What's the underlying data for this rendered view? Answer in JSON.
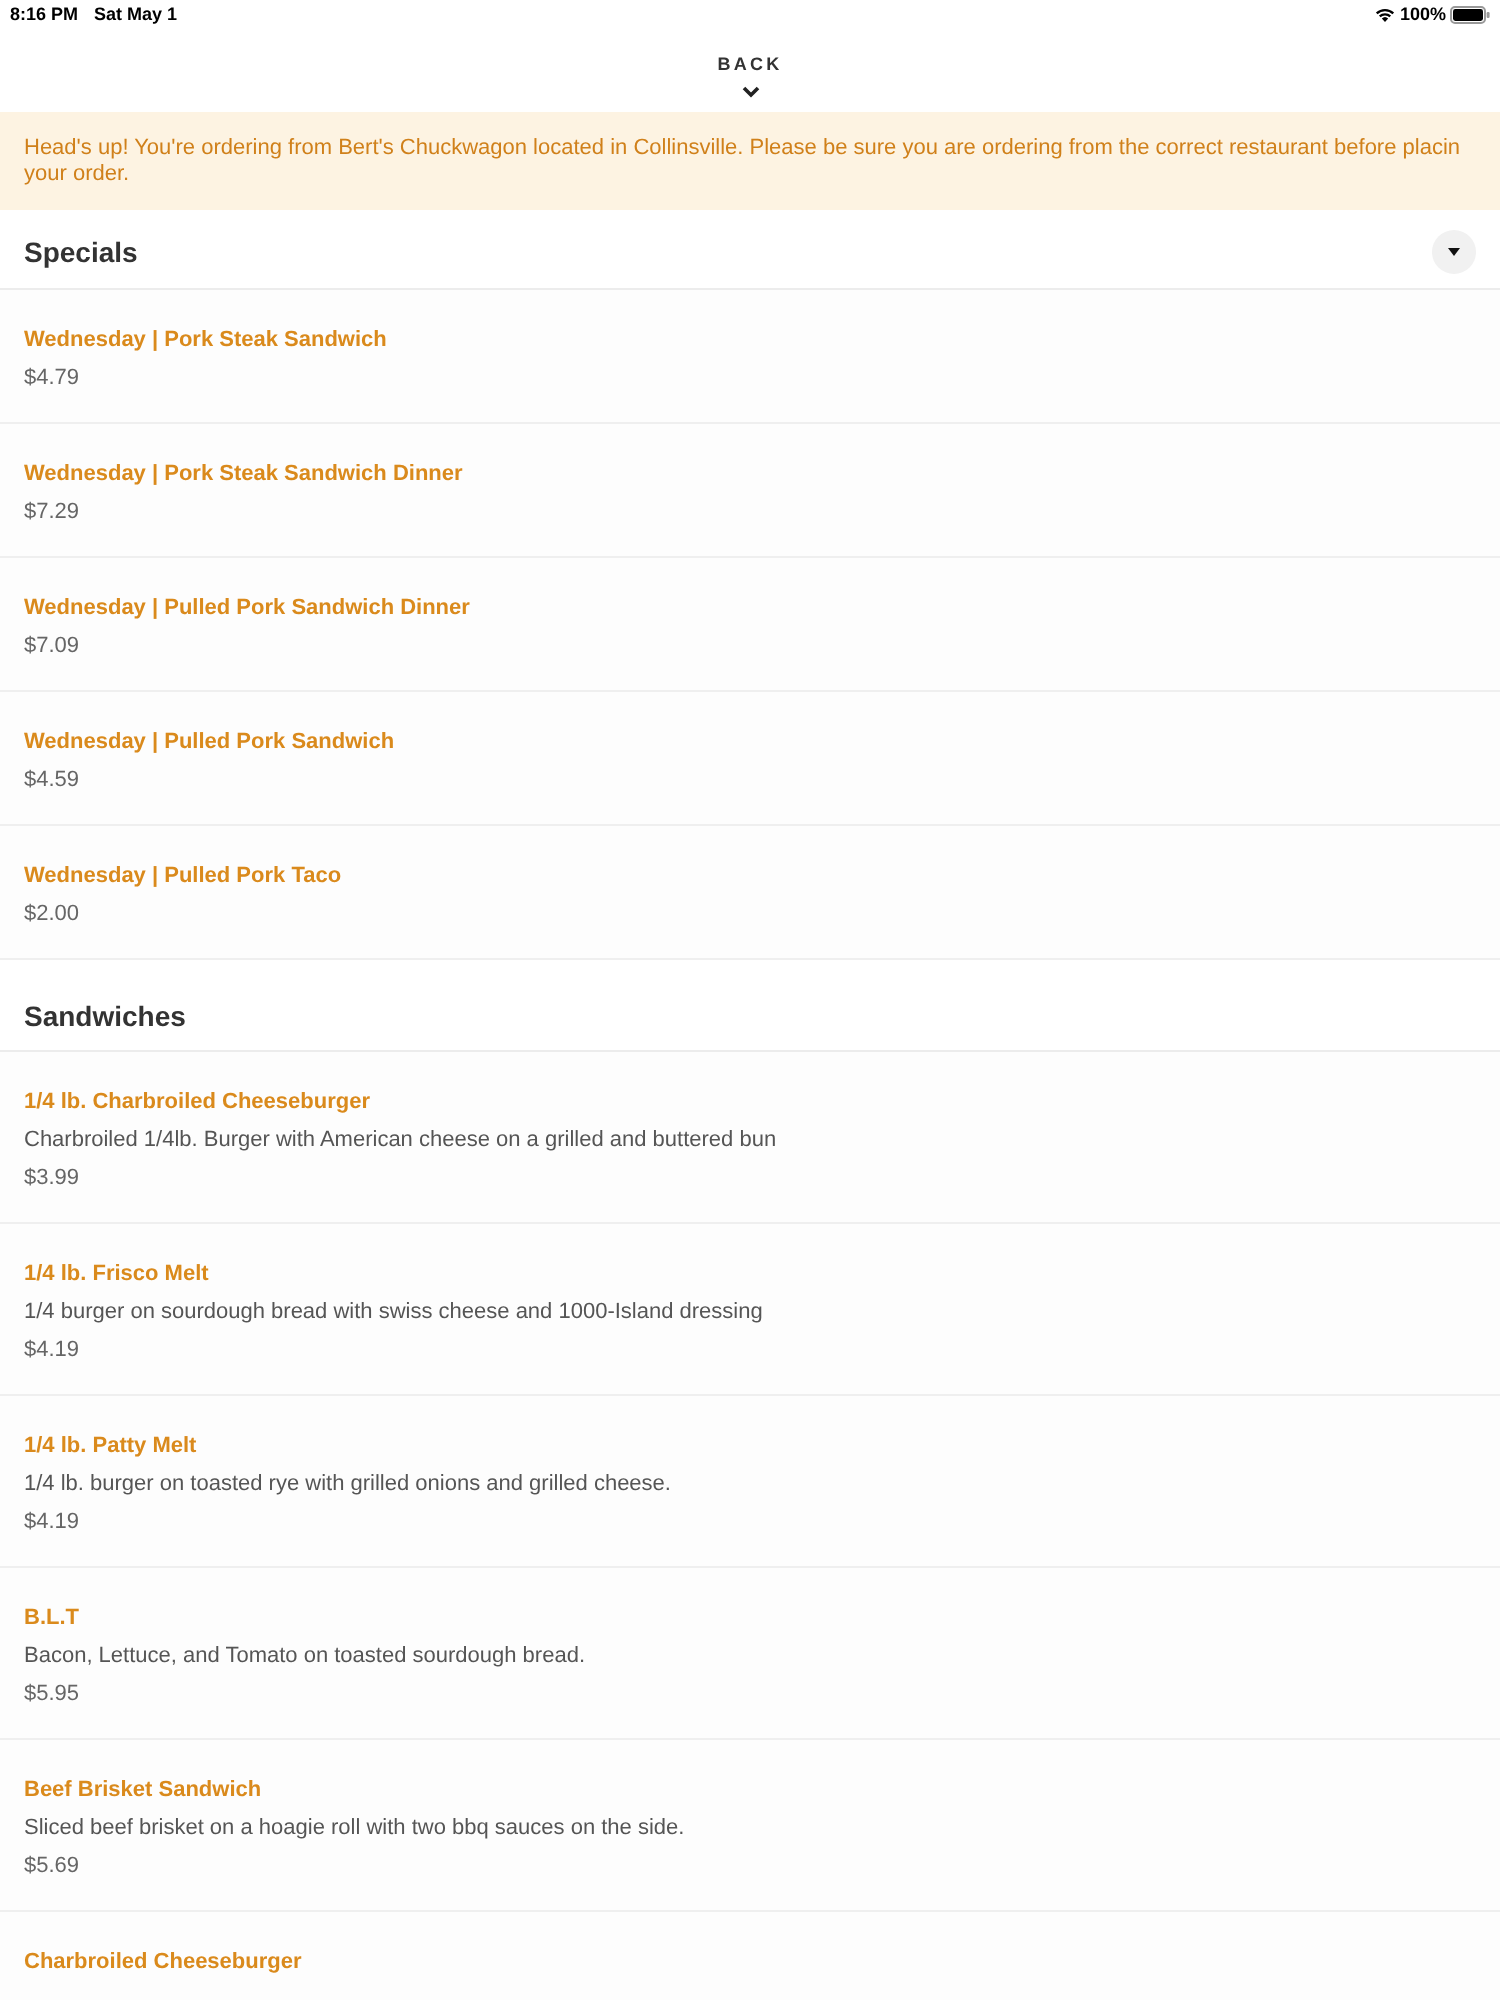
{
  "status_bar": {
    "time": "8:16 PM",
    "date": "Sat May 1",
    "battery_text": "100%"
  },
  "back": {
    "label": "BACK"
  },
  "notice": "Head's up! You're ordering from Bert's Chuckwagon located in Collinsville. Please be sure you are ordering from the correct restaurant before placin your order.",
  "sections": [
    {
      "title": "Specials",
      "has_toggle": true,
      "items": [
        {
          "name": "Wednesday | Pork Steak Sandwich",
          "price": "$4.79"
        },
        {
          "name": "Wednesday | Pork Steak Sandwich Dinner",
          "price": "$7.29"
        },
        {
          "name": "Wednesday | Pulled Pork Sandwich Dinner",
          "price": "$7.09"
        },
        {
          "name": "Wednesday | Pulled Pork Sandwich",
          "price": "$4.59"
        },
        {
          "name": "Wednesday | Pulled Pork Taco",
          "price": "$2.00"
        }
      ]
    },
    {
      "title": "Sandwiches",
      "has_toggle": false,
      "items": [
        {
          "name": "1/4 lb. Charbroiled Cheeseburger",
          "description": "Charbroiled 1/4lb. Burger with American cheese on a grilled and buttered bun",
          "price": "$3.99"
        },
        {
          "name": "1/4 lb. Frisco Melt",
          "description": "1/4 burger on sourdough bread with swiss cheese and 1000-Island dressing",
          "price": "$4.19"
        },
        {
          "name": "1/4 lb. Patty Melt",
          "description": "1/4 lb. burger on toasted rye with grilled onions and grilled cheese.",
          "price": "$4.19"
        },
        {
          "name": "B.L.T",
          "description": "Bacon, Lettuce, and Tomato on toasted sourdough bread.",
          "price": "$5.95"
        },
        {
          "name": "Beef Brisket Sandwich",
          "description": "Sliced beef brisket on a hoagie roll with two bbq sauces on the side.",
          "price": "$5.69"
        },
        {
          "name": "Charbroiled Cheeseburger"
        }
      ]
    }
  ]
}
